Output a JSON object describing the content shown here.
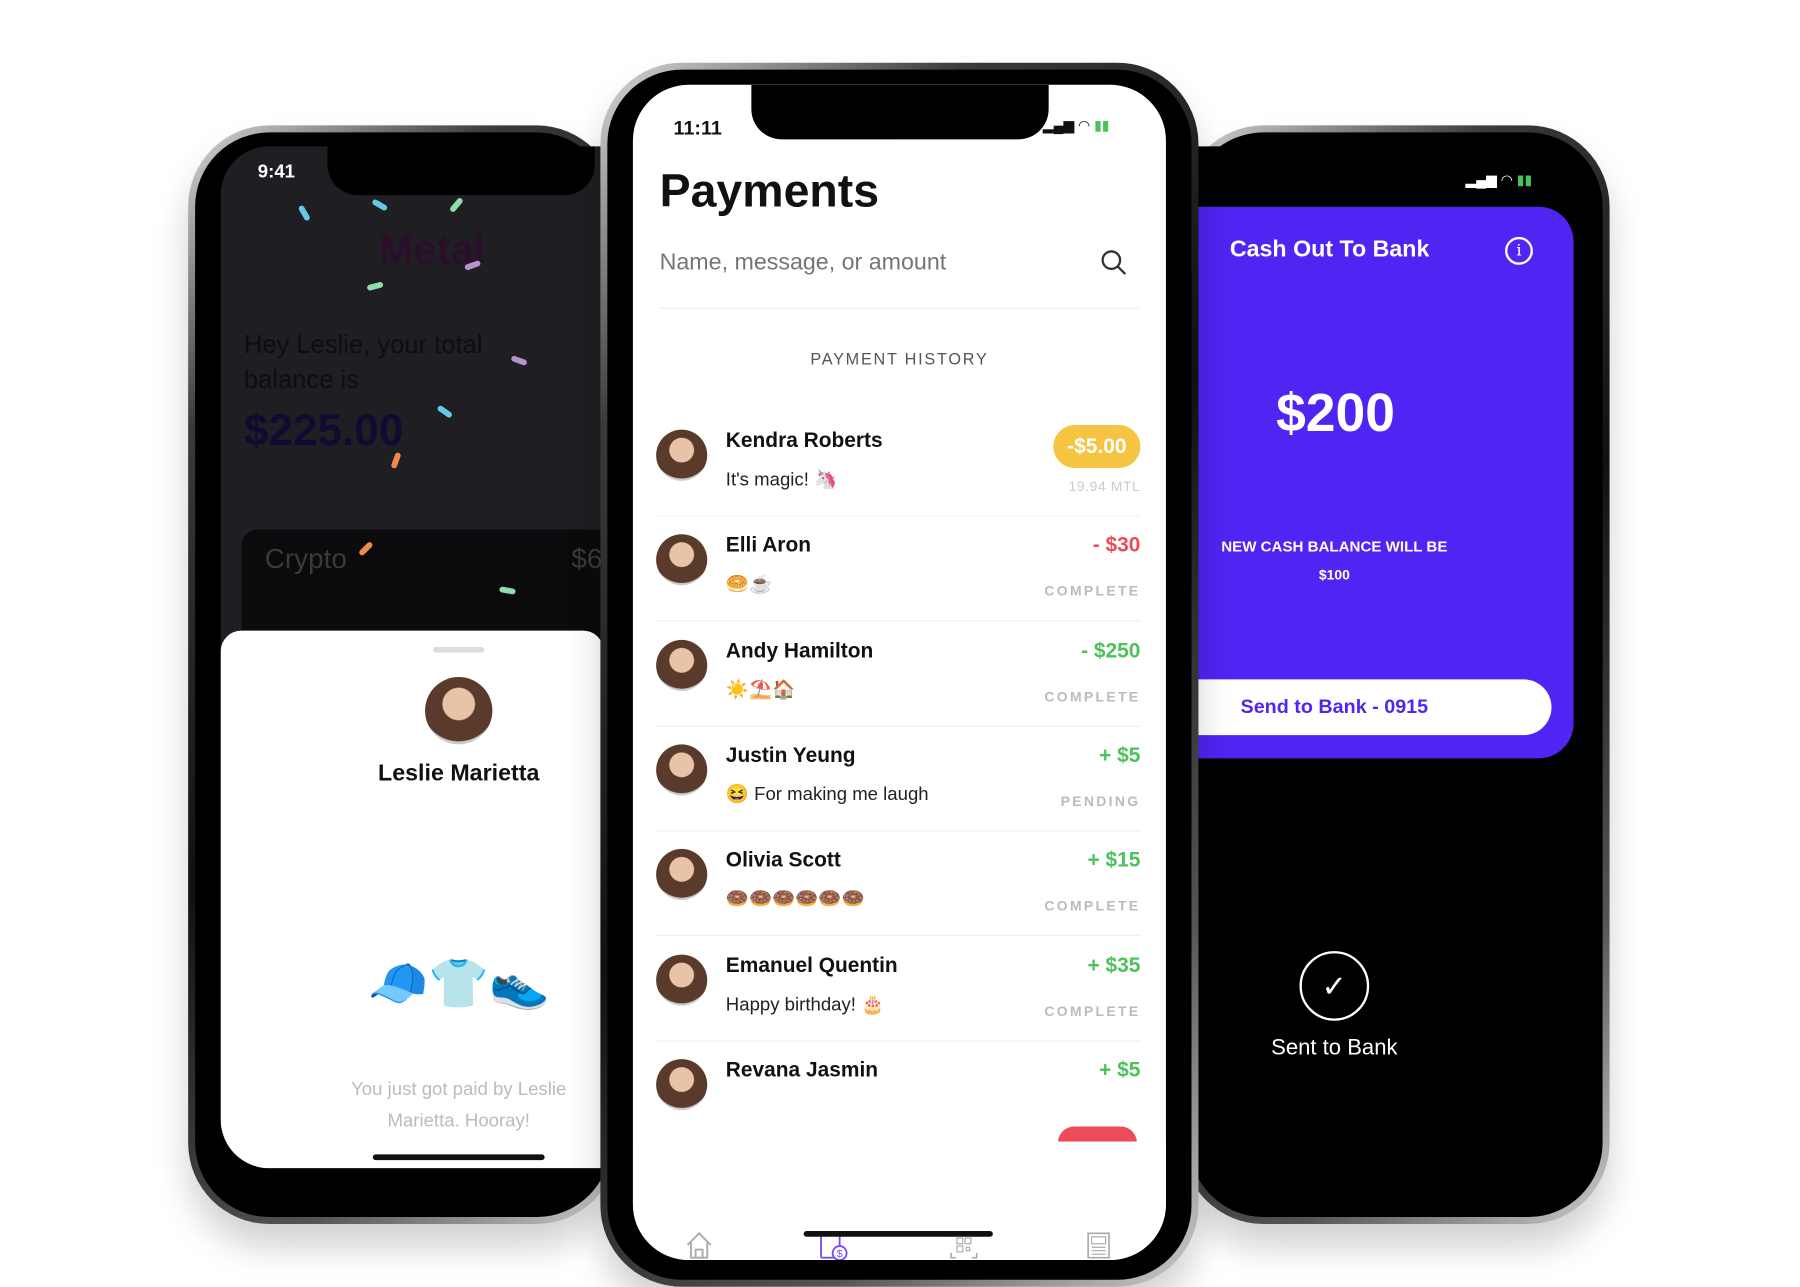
{
  "left_phone": {
    "status_time": "9:41",
    "logo": "Metal",
    "greeting": "Hey Leslie, your total balance is",
    "balance": "$225.00",
    "card_label": "Crypto",
    "card_value_partial": "$6",
    "sheet": {
      "payer_name": "Leslie Marietta",
      "emojis": "🧢👕👟",
      "message": "You just got paid by Leslie Marietta. Hooray!"
    }
  },
  "center_phone": {
    "status_time": "11:11",
    "title": "Payments",
    "search": {
      "placeholder": "Name, message, or amount",
      "icon": "search-icon"
    },
    "section_header": "PAYMENT HISTORY",
    "payments": [
      {
        "name": "Kendra Roberts",
        "memo": "It's magic! 🦄",
        "amount": "-$5.00",
        "sub": "19.94 MTL",
        "type": "badge"
      },
      {
        "name": "Elli Aron",
        "memo": "🥯☕",
        "amount": "- $30",
        "sub": "COMPLETE",
        "type": "debit"
      },
      {
        "name": "Andy Hamilton",
        "memo": "☀️⛱️🏠",
        "amount": "- $250",
        "sub": "COMPLETE",
        "type": "credit"
      },
      {
        "name": "Justin Yeung",
        "memo": "😆 For making me laugh",
        "amount": "+ $5",
        "sub": "PENDING",
        "type": "credit"
      },
      {
        "name": "Olivia Scott",
        "memo": "🍩🍩🍩🍩🍩🍩",
        "amount": "+ $15",
        "sub": "COMPLETE",
        "type": "credit"
      },
      {
        "name": "Emanuel Quentin",
        "memo": "Happy birthday! 🎂",
        "amount": "+ $35",
        "sub": "COMPLETE",
        "type": "credit"
      },
      {
        "name": "Revana Jasmin",
        "memo": "",
        "amount": "+ $5",
        "sub": "",
        "type": "credit"
      }
    ],
    "tabs": [
      {
        "label": "Home",
        "icon": "home-icon",
        "active": false
      },
      {
        "label": "Payments",
        "icon": "payments-icon",
        "active": true
      },
      {
        "label": "Scan",
        "icon": "scan-icon",
        "active": false
      },
      {
        "label": "Discover",
        "icon": "discover-icon",
        "active": false
      }
    ]
  },
  "right_phone": {
    "title": "Cash Out To Bank",
    "amount": "$200",
    "balance_label": "NEW CASH BALANCE WILL BE",
    "balance_value": "$100",
    "button": "Send to Bank - 0915",
    "confirmation": "Sent to Bank"
  },
  "colors": {
    "purple": "#5024f2",
    "yellow": "#f5c443",
    "red": "#ee4b5a",
    "green": "#4cc25a",
    "dark": "#1f1e22"
  }
}
